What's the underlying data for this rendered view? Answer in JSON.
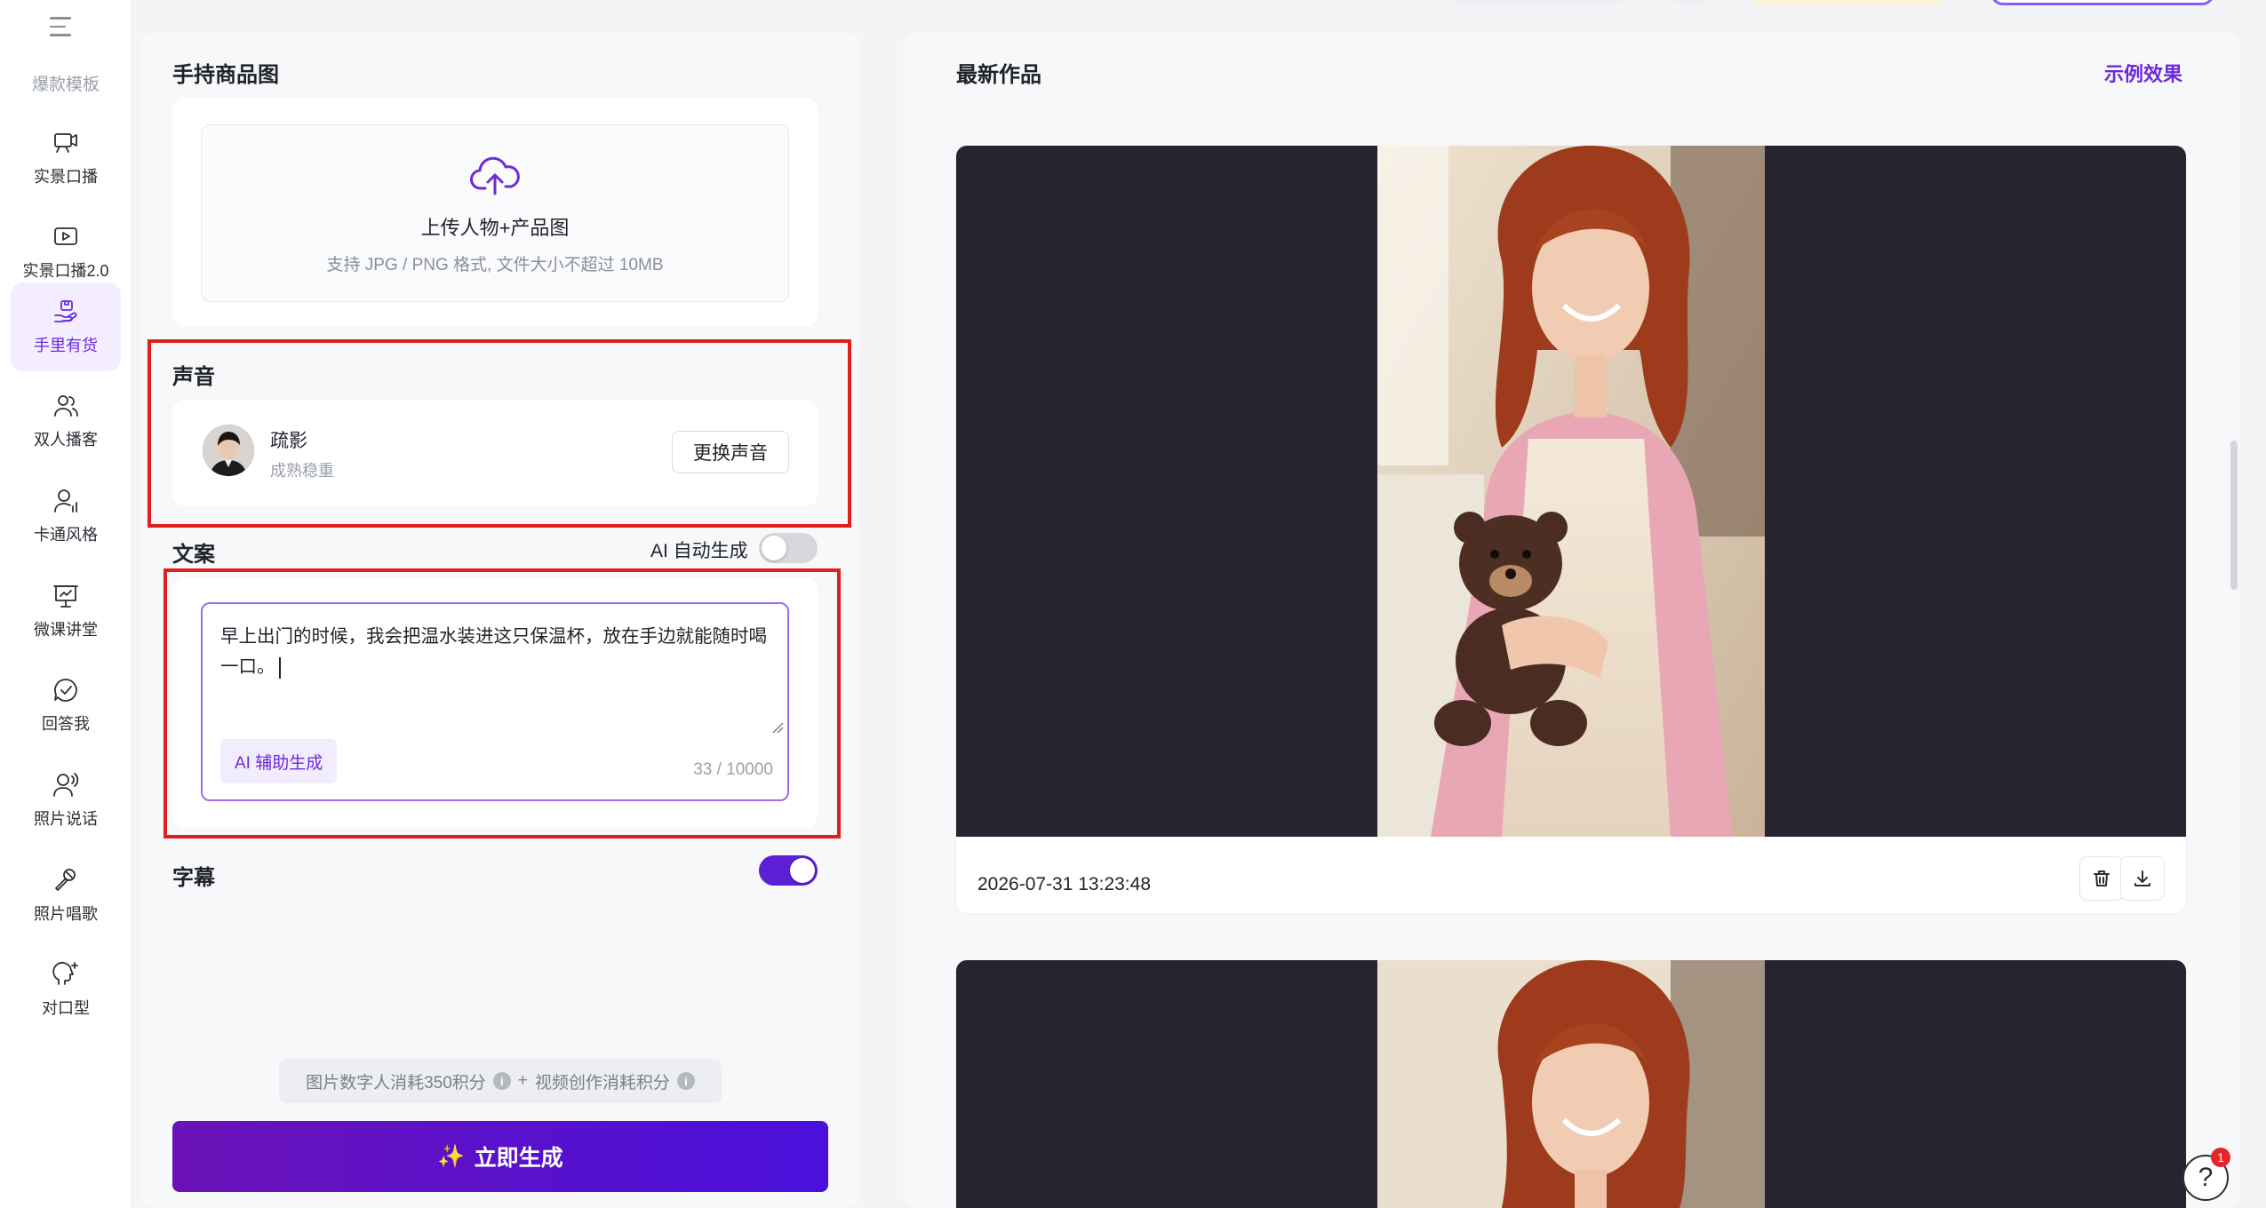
{
  "sidebar": {
    "section_label": "爆款模板",
    "items": [
      {
        "label": "实景口播",
        "icon": "camera-speech-icon"
      },
      {
        "label": "实景口播2.0",
        "icon": "video-play-icon"
      },
      {
        "label": "手里有货",
        "icon": "hand-product-icon"
      },
      {
        "label": "双人播客",
        "icon": "two-people-icon"
      },
      {
        "label": "卡通风格",
        "icon": "cartoon-person-icon"
      },
      {
        "label": "微课讲堂",
        "icon": "presentation-board-icon"
      },
      {
        "label": "回答我",
        "icon": "check-bubble-icon"
      },
      {
        "label": "照片说话",
        "icon": "person-voice-icon"
      },
      {
        "label": "照片唱歌",
        "icon": "microphone-icon"
      },
      {
        "label": "对口型",
        "icon": "lip-sync-head-icon"
      }
    ],
    "active_index": 2
  },
  "left": {
    "product_section_title": "手持商品图",
    "upload": {
      "title": "上传人物+产品图",
      "hint": "支持 JPG / PNG 格式, 文件大小不超过 10MB",
      "icon": "cloud-upload-icon"
    },
    "voice": {
      "section_title": "声音",
      "name": "疏影",
      "description": "成熟稳重",
      "change_button": "更换声音"
    },
    "script": {
      "section_title": "文案",
      "ai_auto_label": "AI 自动生成",
      "ai_auto_enabled": false,
      "text": "早上出门的时候，我会把温水装进这只保温杯，放在手边就能随时喝一口。",
      "ai_assist_button": "AI 辅助生成",
      "char_count": "33 / 10000"
    },
    "subtitle": {
      "section_title": "字幕",
      "enabled": true
    },
    "cost": {
      "part1": "图片数字人消耗350积分",
      "plus": "+",
      "part2": "视频创作消耗积分"
    },
    "generate_button": "立即生成",
    "generate_icon": "✨"
  },
  "right": {
    "title": "最新作品",
    "example_link": "示例效果",
    "works": [
      {
        "timestamp": "2026-07-31 13:23:48"
      }
    ]
  },
  "help": {
    "badge_count": "1",
    "icon": "?"
  },
  "colors": {
    "accent": "#6c2bd9",
    "generate_gradient_start": "#6a12b8",
    "generate_gradient_end": "#4a10dc",
    "highlight_frame": "#e01e1e",
    "preview_bg": "#26252f"
  }
}
